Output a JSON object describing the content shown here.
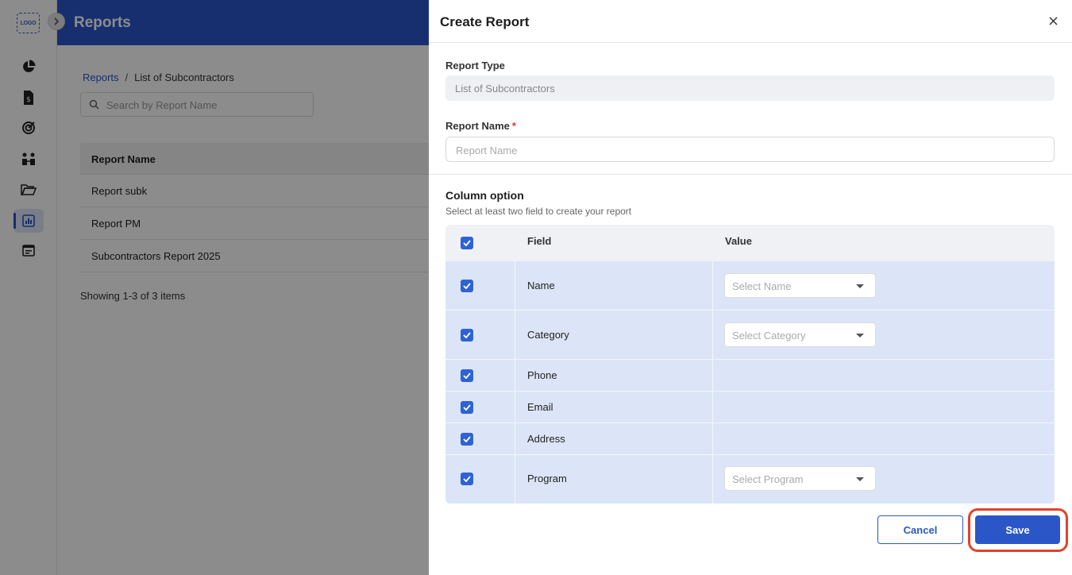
{
  "app": {
    "logo_text": "LOGO",
    "page_title": "Reports"
  },
  "breadcrumb": {
    "root": "Reports",
    "separator": "/",
    "current": "List of Subcontractors"
  },
  "search": {
    "placeholder": "Search by Report Name"
  },
  "report_table": {
    "header": "Report Name",
    "rows": [
      "Report subk",
      "Report PM",
      "Subcontractors Report 2025"
    ]
  },
  "pagination_text": "Showing 1-3 of 3 items",
  "nav_icons": [
    "pie-chart-icon",
    "invoice-dollar-icon",
    "target-icon",
    "team-icon",
    "folder-open-icon",
    "bar-chart-icon",
    "calendar-icon"
  ],
  "modal": {
    "title": "Create Report",
    "report_type_label": "Report Type",
    "report_type_value": "List of Subcontractors",
    "report_name_label": "Report Name",
    "required_mark": "*",
    "report_name_placeholder": "Report Name",
    "column_option_title": "Column option",
    "column_option_sub": "Select at least two field to create your report",
    "columns_header": {
      "field": "Field",
      "value": "Value"
    },
    "columns": [
      {
        "field": "Name",
        "checked": true,
        "select_placeholder": "Select Name"
      },
      {
        "field": "Category",
        "checked": true,
        "select_placeholder": "Select Category"
      },
      {
        "field": "Phone",
        "checked": true
      },
      {
        "field": "Email",
        "checked": true
      },
      {
        "field": "Address",
        "checked": true
      },
      {
        "field": "Program",
        "checked": true,
        "select_placeholder": "Select Program"
      }
    ],
    "cancel_label": "Cancel",
    "save_label": "Save"
  },
  "colors": {
    "primary": "#2a56c8",
    "highlight": "#e4402a",
    "row_bg": "#dbe5f7"
  }
}
